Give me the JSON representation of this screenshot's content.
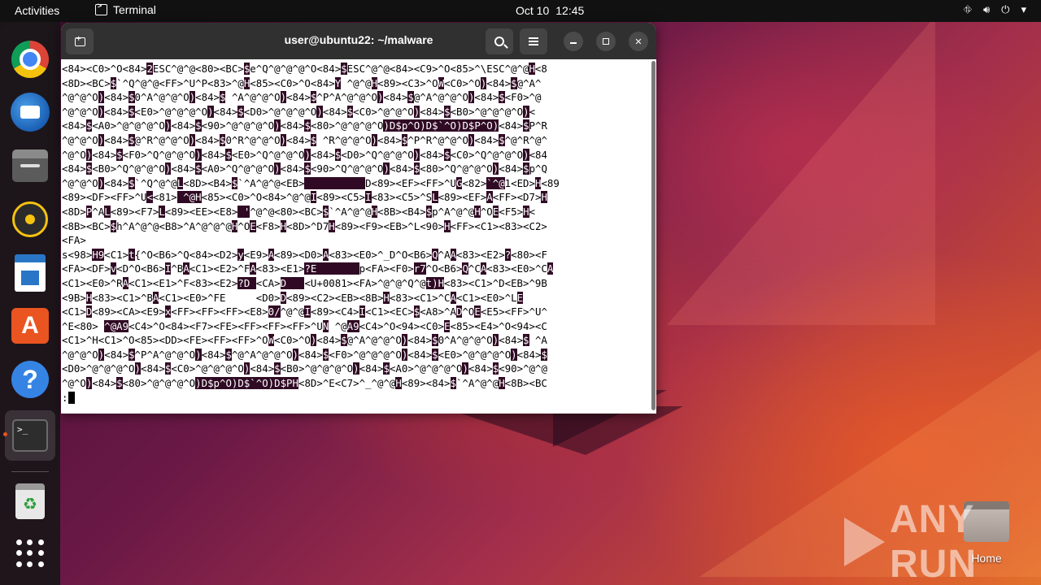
{
  "topbar": {
    "activities": "Activities",
    "app_name": "Terminal",
    "date": "Oct 10",
    "time": "12:45"
  },
  "dock": {
    "items": [
      {
        "name": "chrome-icon"
      },
      {
        "name": "thunderbird-icon"
      },
      {
        "name": "files-icon"
      },
      {
        "name": "rhythmbox-icon"
      },
      {
        "name": "libreoffice-writer-icon"
      },
      {
        "name": "app-center-icon"
      },
      {
        "name": "help-icon"
      },
      {
        "name": "terminal-icon"
      },
      {
        "name": "trash-icon"
      },
      {
        "name": "show-apps-icon"
      }
    ]
  },
  "terminal": {
    "title": "user@ubuntu22: ~/malware",
    "lines": [
      [
        [
          "<84><C0>^O<84>",
          0
        ],
        [
          "2",
          1
        ],
        [
          "ESC^@^@<80><BC>",
          0
        ],
        [
          "$",
          1
        ],
        [
          "e^Q^@^@^@^O<84>",
          0
        ],
        [
          "$",
          1
        ],
        [
          "ESC^@^@<84><C9>^O<85>^\\ESC^@^@",
          0
        ],
        [
          "H",
          1
        ],
        [
          "<8",
          0
        ]
      ],
      [
        [
          "<8D><BC>",
          0
        ],
        [
          "$",
          1
        ],
        [
          "`^Q^@^@<FF>^U^P<83>",
          0
        ],
        [
          "",
          0
        ],
        [
          "^@",
          0
        ],
        [
          "H",
          1
        ],
        [
          "<85><C0>^O<84>",
          0
        ],
        [
          "Y",
          1
        ],
        [
          " ^@^@",
          0
        ],
        [
          "H",
          1
        ],
        [
          "<89><C3>^O",
          0
        ],
        [
          "W",
          1
        ],
        [
          "<C0>^O",
          0
        ],
        [
          ")",
          1
        ],
        [
          "<84>",
          0
        ],
        [
          "$",
          1
        ],
        [
          "@^A^",
          0
        ]
      ],
      [
        [
          "^@^@^O",
          0
        ],
        [
          ")",
          1
        ],
        [
          "<84>",
          0
        ],
        [
          "$",
          1
        ],
        [
          "0",
          0
        ],
        [
          "^A^@^@^O",
          0
        ],
        [
          ")",
          1
        ],
        [
          "<84>",
          0
        ],
        [
          "$",
          1
        ],
        [
          " ^A^@^@^O",
          0
        ],
        [
          ")",
          1
        ],
        [
          "<84>",
          0
        ],
        [
          "$",
          1
        ],
        [
          "^P^A^@^@^O",
          0
        ],
        [
          ")",
          1
        ],
        [
          "<84>",
          0
        ],
        [
          "$",
          1
        ],
        [
          "@^A^@^@^O",
          0
        ],
        [
          ")",
          1
        ],
        [
          "<84>",
          0
        ],
        [
          "$",
          1
        ],
        [
          "<F0>^@",
          0
        ]
      ],
      [
        [
          "^@^@^O",
          0
        ],
        [
          ")",
          1
        ],
        [
          "<84>",
          0
        ],
        [
          "$",
          1
        ],
        [
          "<E0>^@^@^@^O",
          0
        ],
        [
          ")",
          1
        ],
        [
          "<84>",
          0
        ],
        [
          "$",
          1
        ],
        [
          "<D0>^@^@^@^O",
          0
        ],
        [
          ")",
          1
        ],
        [
          "<84>",
          0
        ],
        [
          "$",
          1
        ],
        [
          "<C0>^@^@^O",
          0
        ],
        [
          ")",
          1
        ],
        [
          "<84>",
          0
        ],
        [
          "$",
          1
        ],
        [
          "<B0>^@^@^@^O",
          0
        ],
        [
          ")",
          1
        ],
        [
          "<",
          0
        ]
      ],
      [
        [
          "<84>",
          0
        ],
        [
          "$",
          1
        ],
        [
          "<A0>^@^@^@^O",
          0
        ],
        [
          ")",
          1
        ],
        [
          "<84>",
          0
        ],
        [
          "$",
          1
        ],
        [
          "<90>^@^@^@^O",
          0
        ],
        [
          ")",
          1
        ],
        [
          "<84>",
          0
        ],
        [
          "$",
          1
        ],
        [
          "<80>^@^@^@^O",
          0
        ],
        [
          ")D$p^O)D$`^O)D$P^O)",
          1
        ],
        [
          "<84>",
          0
        ],
        [
          "$",
          1
        ],
        [
          "P^R",
          0
        ]
      ],
      [
        [
          "^@^@^O",
          0
        ],
        [
          ")",
          1
        ],
        [
          "<84>",
          0
        ],
        [
          "$",
          1
        ],
        [
          "@^R^@^@^O",
          0
        ],
        [
          ")",
          1
        ],
        [
          "<84>",
          0
        ],
        [
          "$",
          1
        ],
        [
          "0^R^@^@^O",
          0
        ],
        [
          ")",
          1
        ],
        [
          "<84>",
          0
        ],
        [
          "$",
          1
        ],
        [
          " ^R^@^@^O",
          0
        ],
        [
          ")",
          1
        ],
        [
          "<84>",
          0
        ],
        [
          "$",
          1
        ],
        [
          "^P^R^@^@^O",
          0
        ],
        [
          ")",
          1
        ],
        [
          "<84>",
          0
        ],
        [
          "$",
          1
        ],
        [
          "^@^R^@^",
          0
        ]
      ],
      [
        [
          "^@^O",
          0
        ],
        [
          ")",
          1
        ],
        [
          "<84>",
          0
        ],
        [
          "$",
          1
        ],
        [
          "<F0>^Q^@^@^O",
          0
        ],
        [
          ")",
          1
        ],
        [
          "<84>",
          0
        ],
        [
          "$",
          1
        ],
        [
          "<E0>^Q^@^@^O",
          0
        ],
        [
          ")",
          1
        ],
        [
          "<84>",
          0
        ],
        [
          "$",
          1
        ],
        [
          "<D0>^Q^@^@^O",
          0
        ],
        [
          ")",
          1
        ],
        [
          "<84>",
          0
        ],
        [
          "$",
          1
        ],
        [
          "<C0>^Q^@^@^O",
          0
        ],
        [
          ")",
          1
        ],
        [
          "<84",
          0
        ]
      ],
      [
        [
          "<84>",
          0
        ],
        [
          "$",
          1
        ],
        [
          "<B0>^Q^@^@^O",
          0
        ],
        [
          ")",
          1
        ],
        [
          "<84>",
          0
        ],
        [
          "$",
          1
        ],
        [
          "<A0>^Q^@^@^O",
          0
        ],
        [
          ")",
          1
        ],
        [
          "<84>",
          0
        ],
        [
          "$",
          1
        ],
        [
          "<90>^Q^@^@^O",
          0
        ],
        [
          ")",
          1
        ],
        [
          "<84>",
          0
        ],
        [
          "$",
          1
        ],
        [
          "<80>^Q^@^@^O",
          0
        ],
        [
          ")",
          1
        ],
        [
          "<84>",
          0
        ],
        [
          "$",
          1
        ],
        [
          "p^Q",
          0
        ]
      ],
      [
        [
          "^@^@^O",
          0
        ],
        [
          ")",
          1
        ],
        [
          "<84>",
          0
        ],
        [
          "$",
          1
        ],
        [
          "`^Q^@^@",
          0
        ],
        [
          "L",
          1
        ],
        [
          "<8D><B4>",
          0
        ],
        [
          "$",
          1
        ],
        [
          "`^A^@^@<EB>",
          0
        ],
        [
          "          ",
          1
        ],
        [
          "D<89><EF><FF>^U",
          0
        ],
        [
          "G",
          1
        ],
        [
          "<82>",
          0
        ],
        [
          "`^@",
          1
        ],
        [
          "1<ED>",
          0
        ],
        [
          "H",
          1
        ],
        [
          "<89",
          0
        ]
      ],
      [
        [
          "<89><DF><FF>^U",
          0
        ],
        [
          "<",
          1
        ],
        [
          "<81>",
          0
        ],
        [
          " ^@",
          1
        ],
        [
          "H",
          1
        ],
        [
          "<85><C0>^O<84>^@^@",
          0
        ],
        [
          "I",
          1
        ],
        [
          "<89><C5>",
          0
        ],
        [
          "I",
          1
        ],
        [
          "<83><C5>^S",
          0
        ],
        [
          "L",
          1
        ],
        [
          "<89><EF>",
          0
        ],
        [
          "A",
          1
        ],
        [
          "<FF><D7>",
          0
        ],
        [
          "H",
          1
        ]
      ],
      [
        [
          "<8D>",
          0
        ],
        [
          "P",
          1
        ],
        [
          "^A",
          0
        ],
        [
          "L",
          1
        ],
        [
          "<89><F7>",
          0
        ],
        [
          "L",
          1
        ],
        [
          "<89><EE><E8>",
          0
        ],
        [
          " '",
          1
        ],
        [
          "^@^@<80><BC>",
          0
        ],
        [
          "$",
          1
        ],
        [
          "`^A^@^@",
          0
        ],
        [
          "H",
          1
        ],
        [
          "<8B><B4>",
          0
        ],
        [
          "$",
          1
        ],
        [
          "p^A^@^@",
          0
        ],
        [
          "H",
          1
        ],
        [
          "^O",
          0
        ],
        [
          "E",
          1
        ],
        [
          "<F5>",
          0
        ],
        [
          "H",
          1
        ],
        [
          "<",
          0
        ]
      ],
      [
        [
          "<8B><BC>",
          0
        ],
        [
          "$",
          1
        ],
        [
          "h",
          0
        ],
        [
          "^A^@^@<B8>^A^@^@^@",
          0
        ],
        [
          "H",
          1
        ],
        [
          "^O",
          0
        ],
        [
          "E",
          1
        ],
        [
          "<F8>",
          0
        ],
        [
          "H",
          1
        ],
        [
          "<8D>^D7",
          0
        ],
        [
          "H",
          1
        ],
        [
          "<89><F9><EB>^L<90>",
          0
        ],
        [
          "H",
          1
        ],
        [
          "<FF><C1><83><C2>",
          0
        ]
      ],
      [
        [
          "<FA>",
          0
        ]
      ],
      [
        [
          "s<98>",
          0
        ],
        [
          "H9",
          1
        ],
        [
          "<C1>",
          0
        ],
        [
          "t",
          1
        ],
        [
          "{^O<B6>^Q<84><D2>",
          0
        ],
        [
          "y",
          1
        ],
        [
          "<E9>",
          0
        ],
        [
          "A",
          1
        ],
        [
          "<89><D0>",
          0
        ],
        [
          "A",
          1
        ],
        [
          "<83><E0>^_D^O<B6>",
          0
        ],
        [
          "Q",
          1
        ],
        [
          "^A",
          0
        ],
        [
          "A",
          1
        ],
        [
          "<83><E2>",
          0
        ],
        [
          "?",
          1
        ],
        [
          "<80><F",
          0
        ]
      ],
      [
        [
          "<FA><DF>",
          0
        ],
        [
          "v",
          1
        ],
        [
          "<D^O<B6>",
          0
        ],
        [
          "I",
          1
        ],
        [
          "^B",
          0
        ],
        [
          "A",
          1
        ],
        [
          "<C1><E2>^F",
          0
        ],
        [
          "A",
          1
        ],
        [
          "<83><E1>",
          0
        ],
        [
          "?E       ",
          1
        ],
        [
          "p<FA><F0>",
          0
        ],
        [
          "r7",
          1
        ],
        [
          "^O<B6>",
          0
        ],
        [
          "Q",
          1
        ],
        [
          "^C",
          0
        ],
        [
          "A",
          1
        ],
        [
          "<83><E0>^C",
          0
        ],
        [
          "A",
          1
        ]
      ],
      [
        [
          "<C1><E0>^R",
          0
        ],
        [
          "A",
          1
        ],
        [
          "<C1><E1>^F<83><E2>",
          0
        ],
        [
          "?D ",
          1
        ],
        [
          "<CA>",
          0
        ],
        [
          "D   ",
          1
        ],
        [
          "<U+0081><FA>^@^@^Q^@",
          0
        ],
        [
          "t)",
          1
        ],
        [
          "H",
          1
        ],
        [
          "<83><C1>^D<EB>^9B",
          0
        ]
      ],
      [
        [
          "<9B>",
          0
        ],
        [
          "H",
          1
        ],
        [
          "<83><C1>^B",
          0
        ],
        [
          "A",
          1
        ],
        [
          "<C1><E0>^FE     ",
          0
        ],
        [
          "<D0>",
          0
        ],
        [
          "D",
          1
        ],
        [
          "<89><C2><EB><8B>",
          0
        ],
        [
          "H",
          1
        ],
        [
          "<83><C1>^C",
          0
        ],
        [
          "A",
          1
        ],
        [
          "<C1><E0>^L",
          0
        ],
        [
          "E",
          1
        ]
      ],
      [
        [
          "<C1>",
          0
        ],
        [
          "D",
          1
        ],
        [
          "<89><CA><E9>",
          0
        ],
        [
          "x",
          1
        ],
        [
          "<FF><FF><FF><E8>",
          0
        ],
        [
          "0/",
          1
        ],
        [
          "^@^@",
          0
        ],
        [
          "I",
          1
        ],
        [
          "<89><C4>",
          0
        ],
        [
          "I",
          1
        ],
        [
          "<C1><EC>",
          0
        ],
        [
          "$",
          1
        ],
        [
          "<A8>^A",
          0
        ],
        [
          "D",
          1
        ],
        [
          "^O",
          0
        ],
        [
          "E",
          1
        ],
        [
          "<E5><FF>^U^",
          0
        ]
      ],
      [
        [
          "^E<80>",
          0
        ],
        [
          " ",
          0
        ],
        [
          "^@A9",
          1
        ],
        [
          "<C4>^O<84><F7><FE><FF><FF><FF>^U",
          0
        ],
        [
          "N",
          1
        ],
        [
          " ^@",
          0
        ],
        [
          "A9",
          1
        ],
        [
          "<C4>^O<94><C0>",
          0
        ],
        [
          "E",
          1
        ],
        [
          "<85><E4>^O<94><C",
          0
        ]
      ],
      [
        [
          "<C1>^H<C1>^O<85><DD><FE><FF><FF>^O",
          0
        ],
        [
          "W",
          1
        ],
        [
          "<C0>^O",
          0
        ],
        [
          ")",
          1
        ],
        [
          "<84>",
          0
        ],
        [
          "$",
          1
        ],
        [
          "@^A^@^@^O",
          0
        ],
        [
          ")",
          1
        ],
        [
          "<84>",
          0
        ],
        [
          "$",
          1
        ],
        [
          "0",
          0
        ],
        [
          "^A^@^@^O",
          0
        ],
        [
          ")",
          1
        ],
        [
          "<84>",
          0
        ],
        [
          "$",
          1
        ],
        [
          " ^A",
          0
        ]
      ],
      [
        [
          "^@^@^O",
          0
        ],
        [
          ")",
          1
        ],
        [
          "<84>",
          0
        ],
        [
          "$",
          1
        ],
        [
          "^P^A^@^@^O",
          0
        ],
        [
          ")",
          1
        ],
        [
          "<84>",
          0
        ],
        [
          "$",
          1
        ],
        [
          "^@^A^@^@^O",
          0
        ],
        [
          ")",
          1
        ],
        [
          "<84>",
          0
        ],
        [
          "$",
          1
        ],
        [
          "<F0>^@^@^@^O",
          0
        ],
        [
          ")",
          1
        ],
        [
          "<84>",
          0
        ],
        [
          "$",
          1
        ],
        [
          "<E0>^@^@^@^O",
          0
        ],
        [
          ")",
          1
        ],
        [
          "<84>",
          0
        ],
        [
          "$",
          1
        ]
      ],
      [
        [
          "<D0>^@^@^@^O",
          0
        ],
        [
          ")",
          1
        ],
        [
          "<84>",
          0
        ],
        [
          "$",
          1
        ],
        [
          "<C0>^@^@^@^O",
          0
        ],
        [
          ")",
          1
        ],
        [
          "<84>",
          0
        ],
        [
          "$",
          1
        ],
        [
          "<B0>^@^@^@^O",
          0
        ],
        [
          ")",
          1
        ],
        [
          "<84>",
          0
        ],
        [
          "$",
          1
        ],
        [
          "<A0>^@^@^@^O",
          0
        ],
        [
          ")",
          1
        ],
        [
          "<84>",
          0
        ],
        [
          "$",
          1
        ],
        [
          "<90>^@^@",
          0
        ]
      ],
      [
        [
          "^@^O",
          0
        ],
        [
          ")",
          1
        ],
        [
          "<84>",
          0
        ],
        [
          "$",
          1
        ],
        [
          "<80>^@^@^@^O",
          0
        ],
        [
          ")D$p^O)D$`^O)D$P",
          1
        ],
        [
          "H",
          1
        ],
        [
          "<8D>^E<C7>^_^@^@",
          0
        ],
        [
          "H",
          1
        ],
        [
          "<89><84>",
          0
        ],
        [
          "$",
          1
        ],
        [
          "`^A^@^@",
          0
        ],
        [
          "H",
          1
        ],
        [
          "<8B><BC",
          0
        ]
      ],
      [
        [
          ":",
          0
        ]
      ]
    ]
  },
  "desktop": {
    "home_label": "Home",
    "watermark": "ANY RUN"
  }
}
